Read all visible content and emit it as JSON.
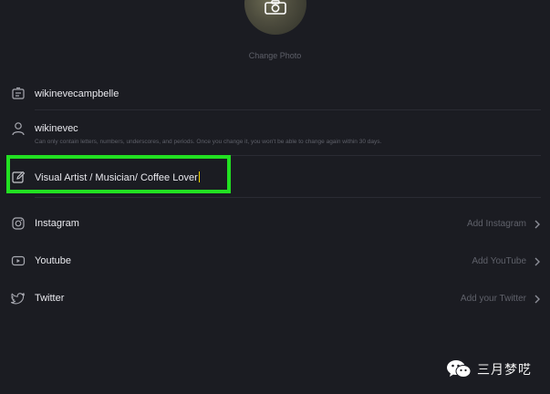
{
  "profile": {
    "change_photo_label": "Change Photo"
  },
  "fields": {
    "name": "wikinevecampbelle",
    "username": "wikinevec",
    "username_hint": "Can only contain letters, numbers, underscores, and periods. Once you change it, you won't be able to change again within 30 days.",
    "bio": "Visual Artist / Musician/ Coffee Lover"
  },
  "social": [
    {
      "label": "Instagram",
      "action": "Add Instagram",
      "icon": "instagram-icon"
    },
    {
      "label": "Youtube",
      "action": "Add YouTube",
      "icon": "youtube-icon"
    },
    {
      "label": "Twitter",
      "action": "Add your Twitter",
      "icon": "twitter-icon"
    }
  ],
  "highlight_color": "#22e022",
  "watermark": {
    "text": "三月梦呓"
  }
}
